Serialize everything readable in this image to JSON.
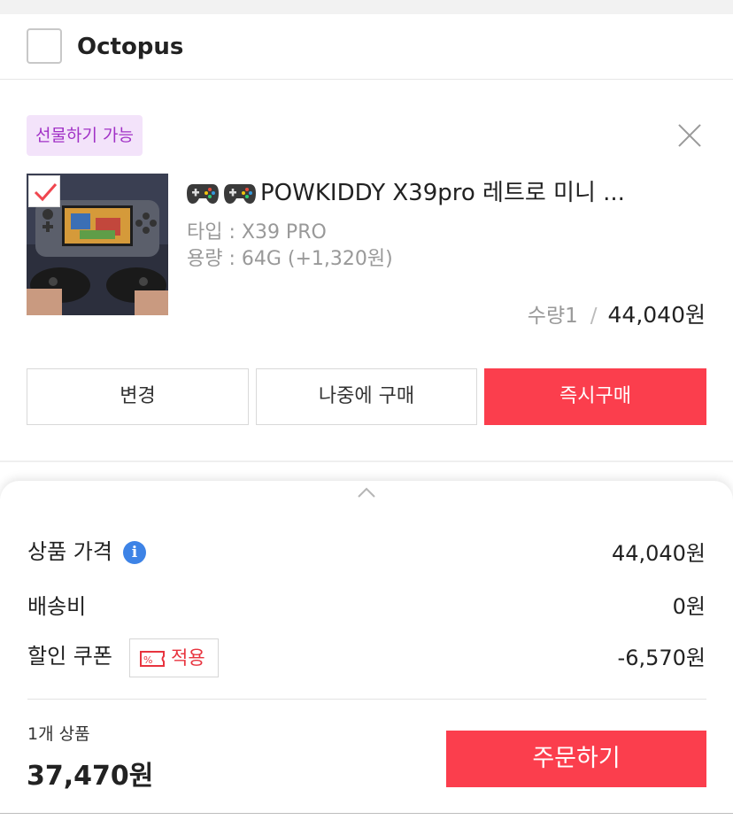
{
  "store": {
    "name": "Octopus",
    "checked": false
  },
  "item": {
    "gift_badge": "선물하기 가능",
    "title": "POWKIDDY X39pro 레트로 미니 ...",
    "title_icons": [
      "gamepad-icon",
      "gamepad-icon"
    ],
    "option_type": "타입 : X39 PRO",
    "option_storage": "용량 : 64G (+1,320원)",
    "quantity": "수량1",
    "separator": "/",
    "price": "44,040원",
    "checked": true
  },
  "actions": {
    "change": "변경",
    "buy_later": "나중에 구매",
    "buy_now": "즉시구매"
  },
  "summary": {
    "product_price_label": "상품 가격",
    "product_price": "44,040원",
    "shipping_label": "배송비",
    "shipping": "0원",
    "coupon_label": "할인 쿠폰",
    "coupon_button": "적용",
    "coupon_discount": "-6,570원",
    "item_count": "1개 상품",
    "total": "37,470원",
    "order_button": "주문하기"
  },
  "colors": {
    "accent": "#fb3e4d",
    "gift_badge_bg": "#f3e3fa",
    "gift_badge_text": "#a131c6",
    "info_icon": "#3d83e6"
  }
}
